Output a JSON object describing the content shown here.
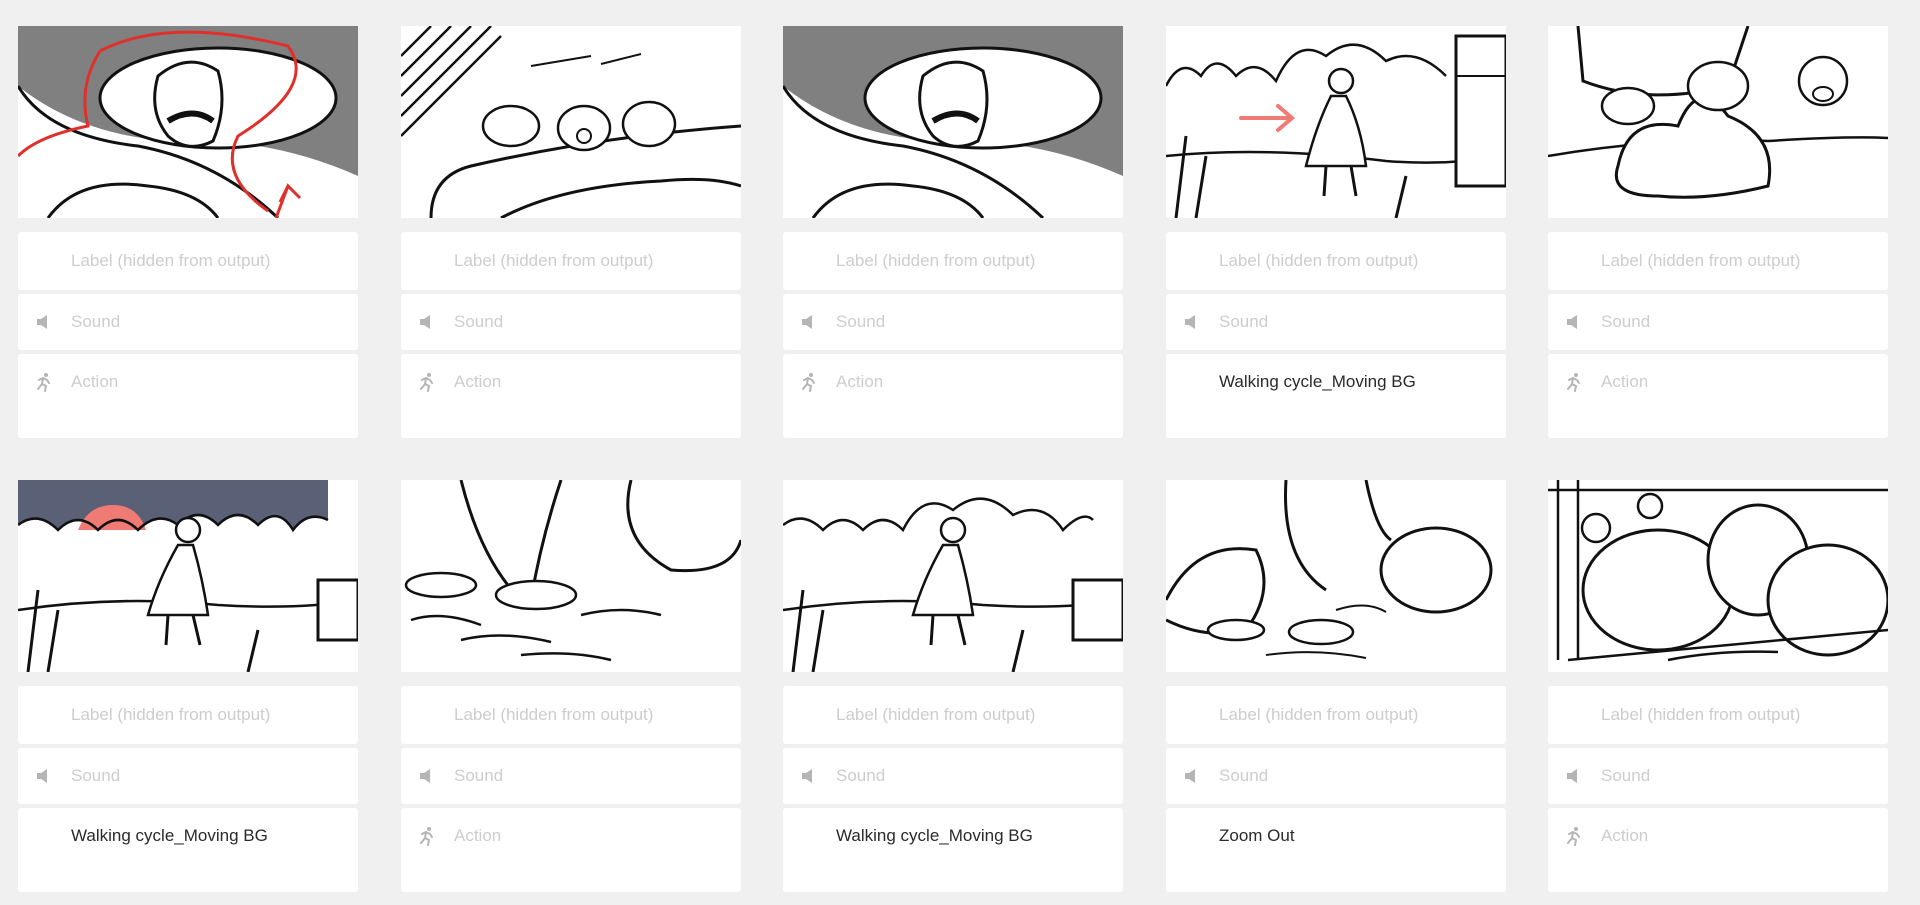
{
  "panels": [
    {
      "label_placeholder": "Label (hidden from output)",
      "sound_placeholder": "Sound",
      "action_placeholder": "Action",
      "action_value": ""
    },
    {
      "label_placeholder": "Label (hidden from output)",
      "sound_placeholder": "Sound",
      "action_placeholder": "Action",
      "action_value": ""
    },
    {
      "label_placeholder": "Label (hidden from output)",
      "sound_placeholder": "Sound",
      "action_placeholder": "Action",
      "action_value": ""
    },
    {
      "label_placeholder": "Label (hidden from output)",
      "sound_placeholder": "Sound",
      "action_placeholder": "",
      "action_value": "Walking cycle_Moving BG"
    },
    {
      "label_placeholder": "Label (hidden from output)",
      "sound_placeholder": "Sound",
      "action_placeholder": "Action",
      "action_value": ""
    },
    {
      "label_placeholder": "Label (hidden from output)",
      "sound_placeholder": "Sound",
      "action_placeholder": "",
      "action_value": "Walking cycle_Moving BG"
    },
    {
      "label_placeholder": "Label (hidden from output)",
      "sound_placeholder": "Sound",
      "action_placeholder": "Action",
      "action_value": ""
    },
    {
      "label_placeholder": "Label (hidden from output)",
      "sound_placeholder": "Sound",
      "action_placeholder": "",
      "action_value": "Walking cycle_Moving BG"
    },
    {
      "label_placeholder": "Label (hidden from output)",
      "sound_placeholder": "Sound",
      "action_placeholder": "",
      "action_value": "Zoom Out"
    },
    {
      "label_placeholder": "Label (hidden from output)",
      "sound_placeholder": "Sound",
      "action_placeholder": "Action",
      "action_value": ""
    }
  ],
  "icons": {
    "sound": "speaker-icon",
    "action": "running-figure-icon"
  },
  "colors": {
    "background": "#f0f0f0",
    "placeholder_text": "#cdcdcd",
    "filled_text": "#2a2a2a",
    "icon": "#b5b5b5",
    "sketch_red": "#e0302b",
    "sketch_pink": "#f07a74",
    "sky_gray": "#7f7f7f",
    "sky_dusk": "#5a6176"
  }
}
